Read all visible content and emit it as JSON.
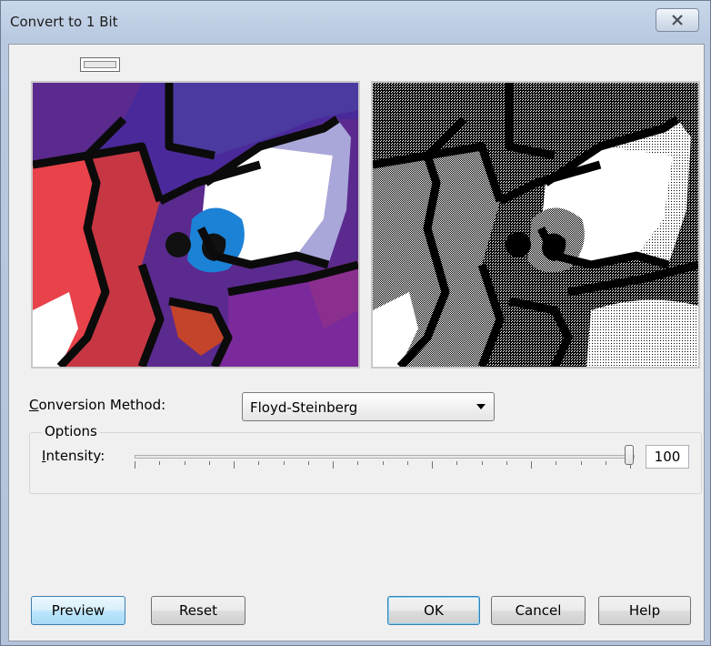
{
  "window": {
    "title": "Convert to 1 Bit",
    "close_label": "☒"
  },
  "toolbar": {
    "toggle_icon": "preview-toggle-icon"
  },
  "conversion": {
    "label_prefix": "C",
    "label_rest": "onversion Method:",
    "selected": "Floyd-Steinberg"
  },
  "options": {
    "group_title": "Options",
    "intensity_prefix": "I",
    "intensity_rest": "ntensity:",
    "intensity_value": "100",
    "intensity_fraction": 1.0
  },
  "buttons": {
    "preview": "Preview",
    "reset": "Reset",
    "ok": "OK",
    "cancel": "Cancel",
    "help": "Help"
  },
  "colors": {
    "focus_blue": "#3c7fb1",
    "preview_purple": "#5b2a8e",
    "preview_red": "#e03a3a",
    "preview_blue": "#1b82d6",
    "preview_lavender": "#a9a7d9"
  }
}
